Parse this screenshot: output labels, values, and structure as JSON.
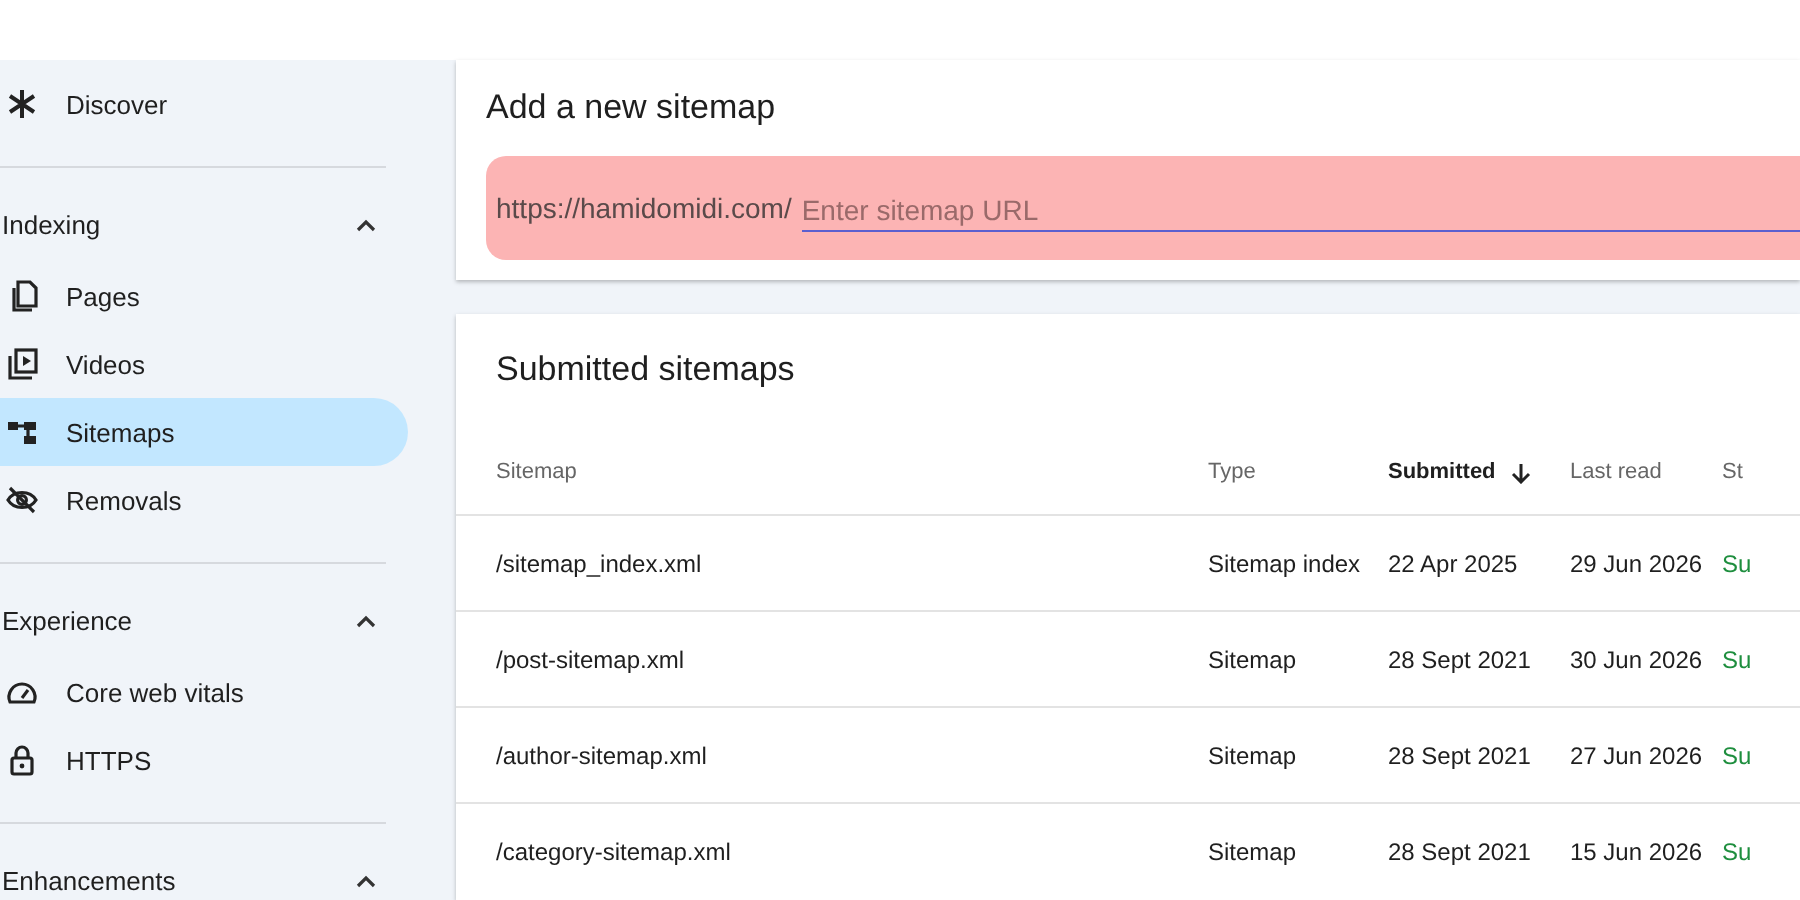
{
  "sidebar": {
    "items": [
      {
        "kind": "item",
        "label": "Discover",
        "selected": false
      },
      {
        "kind": "section",
        "label": "Indexing",
        "expanded": true
      },
      {
        "kind": "item",
        "label": "Pages",
        "selected": false
      },
      {
        "kind": "item",
        "label": "Videos",
        "selected": false
      },
      {
        "kind": "item",
        "label": "Sitemaps",
        "selected": true
      },
      {
        "kind": "item",
        "label": "Removals",
        "selected": false
      },
      {
        "kind": "section",
        "label": "Experience",
        "expanded": true
      },
      {
        "kind": "item",
        "label": "Core web vitals",
        "selected": false
      },
      {
        "kind": "item",
        "label": "HTTPS",
        "selected": false
      },
      {
        "kind": "section",
        "label": "Enhancements",
        "expanded": true
      }
    ]
  },
  "add_sitemap": {
    "title": "Add a new sitemap",
    "prefix": "https://hamidomidi.com/",
    "placeholder": "Enter sitemap URL"
  },
  "submitted": {
    "title": "Submitted sitemaps",
    "columns": [
      {
        "label": "Sitemap",
        "sorted": false
      },
      {
        "label": "Type",
        "sorted": false
      },
      {
        "label": "Submitted",
        "sorted": true
      },
      {
        "label": "Last read",
        "sorted": false
      },
      {
        "label": "St",
        "sorted": false
      }
    ],
    "rows": [
      [
        "/sitemap_index.xml",
        "Sitemap index",
        "22 Apr 2025",
        "29 Jun 2026",
        "Su"
      ],
      [
        "/post-sitemap.xml",
        "Sitemap",
        "28 Sept 2021",
        "30 Jun 2026",
        "Su"
      ],
      [
        "/author-sitemap.xml",
        "Sitemap",
        "28 Sept 2021",
        "27 Jun 2026",
        "Su"
      ],
      [
        "/category-sitemap.xml",
        "Sitemap",
        "28 Sept 2021",
        "15 Jun 2026",
        "Su"
      ]
    ]
  }
}
